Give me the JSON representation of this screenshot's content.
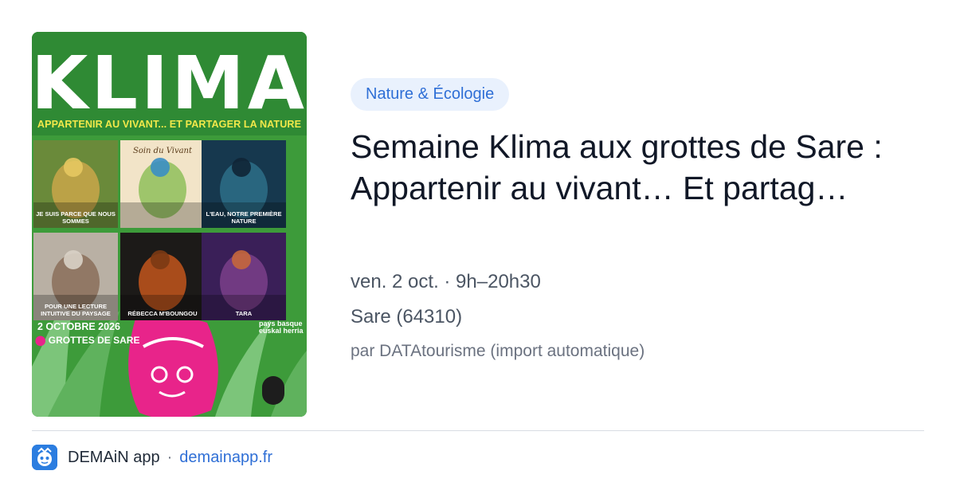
{
  "poster": {
    "title": "KLIMA",
    "tagline": "APPARTENIR AU VIVANT... ET PARTAGER LA NATURE",
    "tiles": [
      {
        "caption": "JE SUIS PARCE QUE NOUS SOMMES",
        "colors": [
          "#6a8a3a",
          "#c9a64a",
          "#e7c860"
        ]
      },
      {
        "title": "Soin du Vivant",
        "caption": "",
        "colors": [
          "#f2e4c8",
          "#8fbf5a",
          "#3a8ec4"
        ]
      },
      {
        "caption": "L'EAU, NOTRE PREMIÈRE NATURE",
        "colors": [
          "#16384e",
          "#2d6f88",
          "#0f2536"
        ]
      },
      {
        "caption": "POUR UNE LECTURE INTUITIVE DU PAYSAGE",
        "colors": [
          "#b9b0a4",
          "#8a6e5a",
          "#d9d2c6"
        ]
      },
      {
        "caption": "RÉBECCA M'BOUNGOU",
        "colors": [
          "#1c1a18",
          "#c2561c",
          "#7b3a14"
        ]
      },
      {
        "caption": "TARA",
        "colors": [
          "#3a1f58",
          "#7b3f8a",
          "#c5673c"
        ]
      }
    ],
    "date": "2 OCTOBRE 2026",
    "place": "GROTTES DE SARE",
    "brand": "pays basque euskal herria"
  },
  "category": "Nature & Écologie",
  "title": "Semaine Klima aux grottes de Sare : Appartenir au vivant… Et partag…",
  "when": "ven. 2 oct. · 9h–20h30",
  "where": "Sare (64310)",
  "source": "par DATAtourisme (import automatique)",
  "footer": {
    "app_name": "DEMAiN app",
    "separator": "·",
    "domain": "demainapp.fr"
  },
  "colors": {
    "accent": "#2f6fd6",
    "chip_bg": "#e9f1fd",
    "poster_green": "#3d9b3a",
    "poster_pink": "#e8248a",
    "poster_yellow": "#f2e84a"
  }
}
